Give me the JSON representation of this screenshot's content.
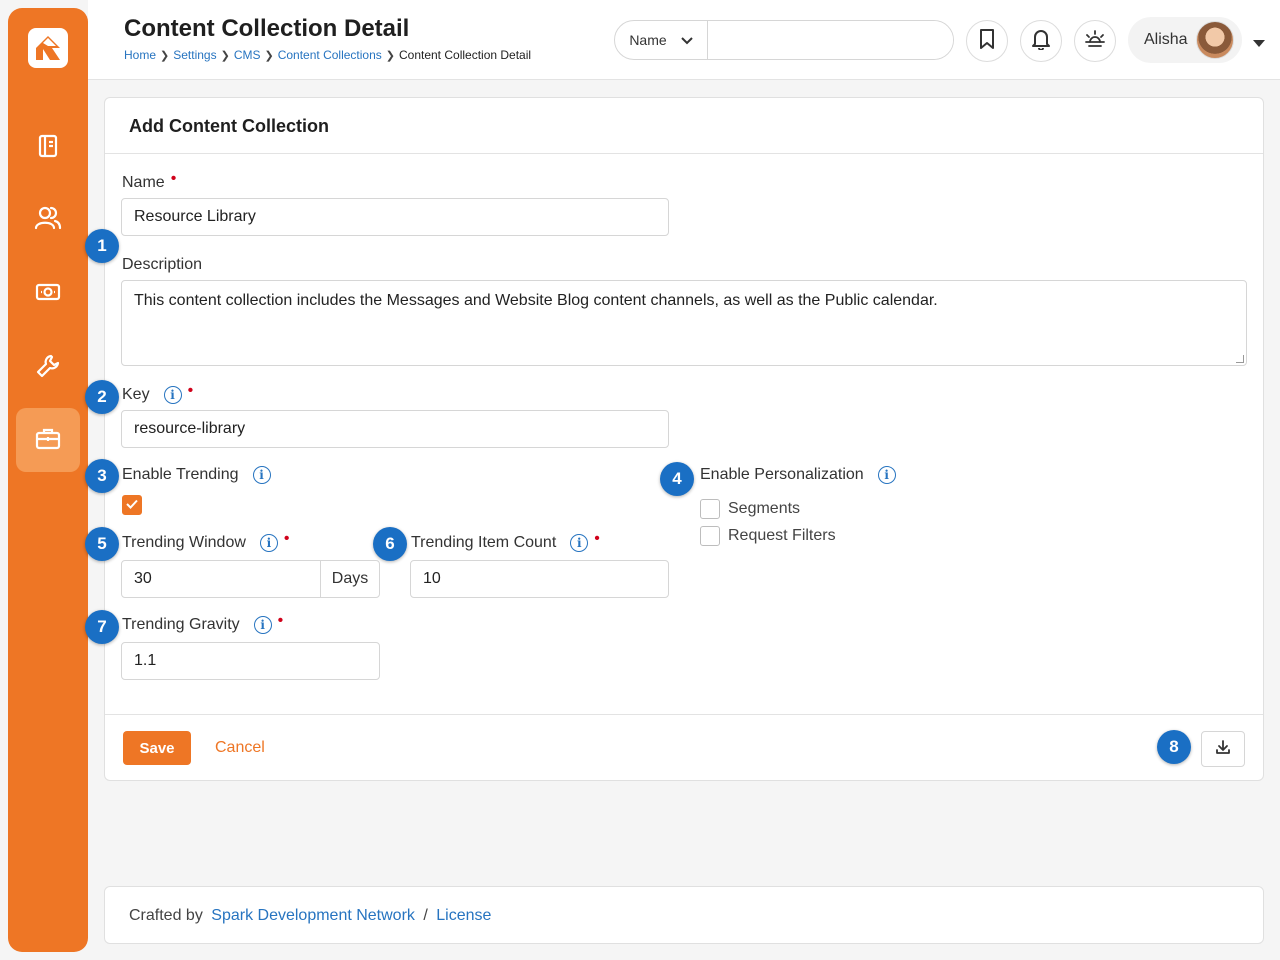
{
  "header": {
    "title": "Content Collection Detail",
    "breadcrumb": [
      "Home",
      "Settings",
      "CMS",
      "Content Collections",
      "Content Collection Detail"
    ],
    "search_type": "Name",
    "search_value": "",
    "user_name": "Alisha"
  },
  "sidebar": {
    "icons": [
      "logo-icon",
      "notebook-icon",
      "people-icon",
      "money-icon",
      "wrench-icon",
      "briefcase-icon"
    ],
    "accent": "#ee7625"
  },
  "card": {
    "title": "Add Content Collection",
    "name_label": "Name",
    "name_value": "Resource Library",
    "description_label": "Description",
    "description_value": "This content collection includes the Messages and Website Blog content channels, as well as the Public calendar.",
    "key_label": "Key",
    "key_value": "resource-library",
    "enable_trending_label": "Enable Trending",
    "enable_trending_checked": true,
    "enable_personalization_label": "Enable Personalization",
    "personalization_options": [
      "Segments",
      "Request Filters"
    ],
    "trending_window_label": "Trending Window",
    "trending_window_value": "30",
    "trending_window_unit": "Days",
    "trending_item_count_label": "Trending Item Count",
    "trending_item_count_value": "10",
    "trending_gravity_label": "Trending Gravity",
    "trending_gravity_value": "1.1",
    "save_label": "Save",
    "cancel_label": "Cancel"
  },
  "badges": [
    "1",
    "2",
    "3",
    "4",
    "5",
    "6",
    "7",
    "8"
  ],
  "footer": {
    "prefix": "Crafted by",
    "org_link": "Spark Development Network",
    "separator": "/",
    "license_link": "License"
  }
}
